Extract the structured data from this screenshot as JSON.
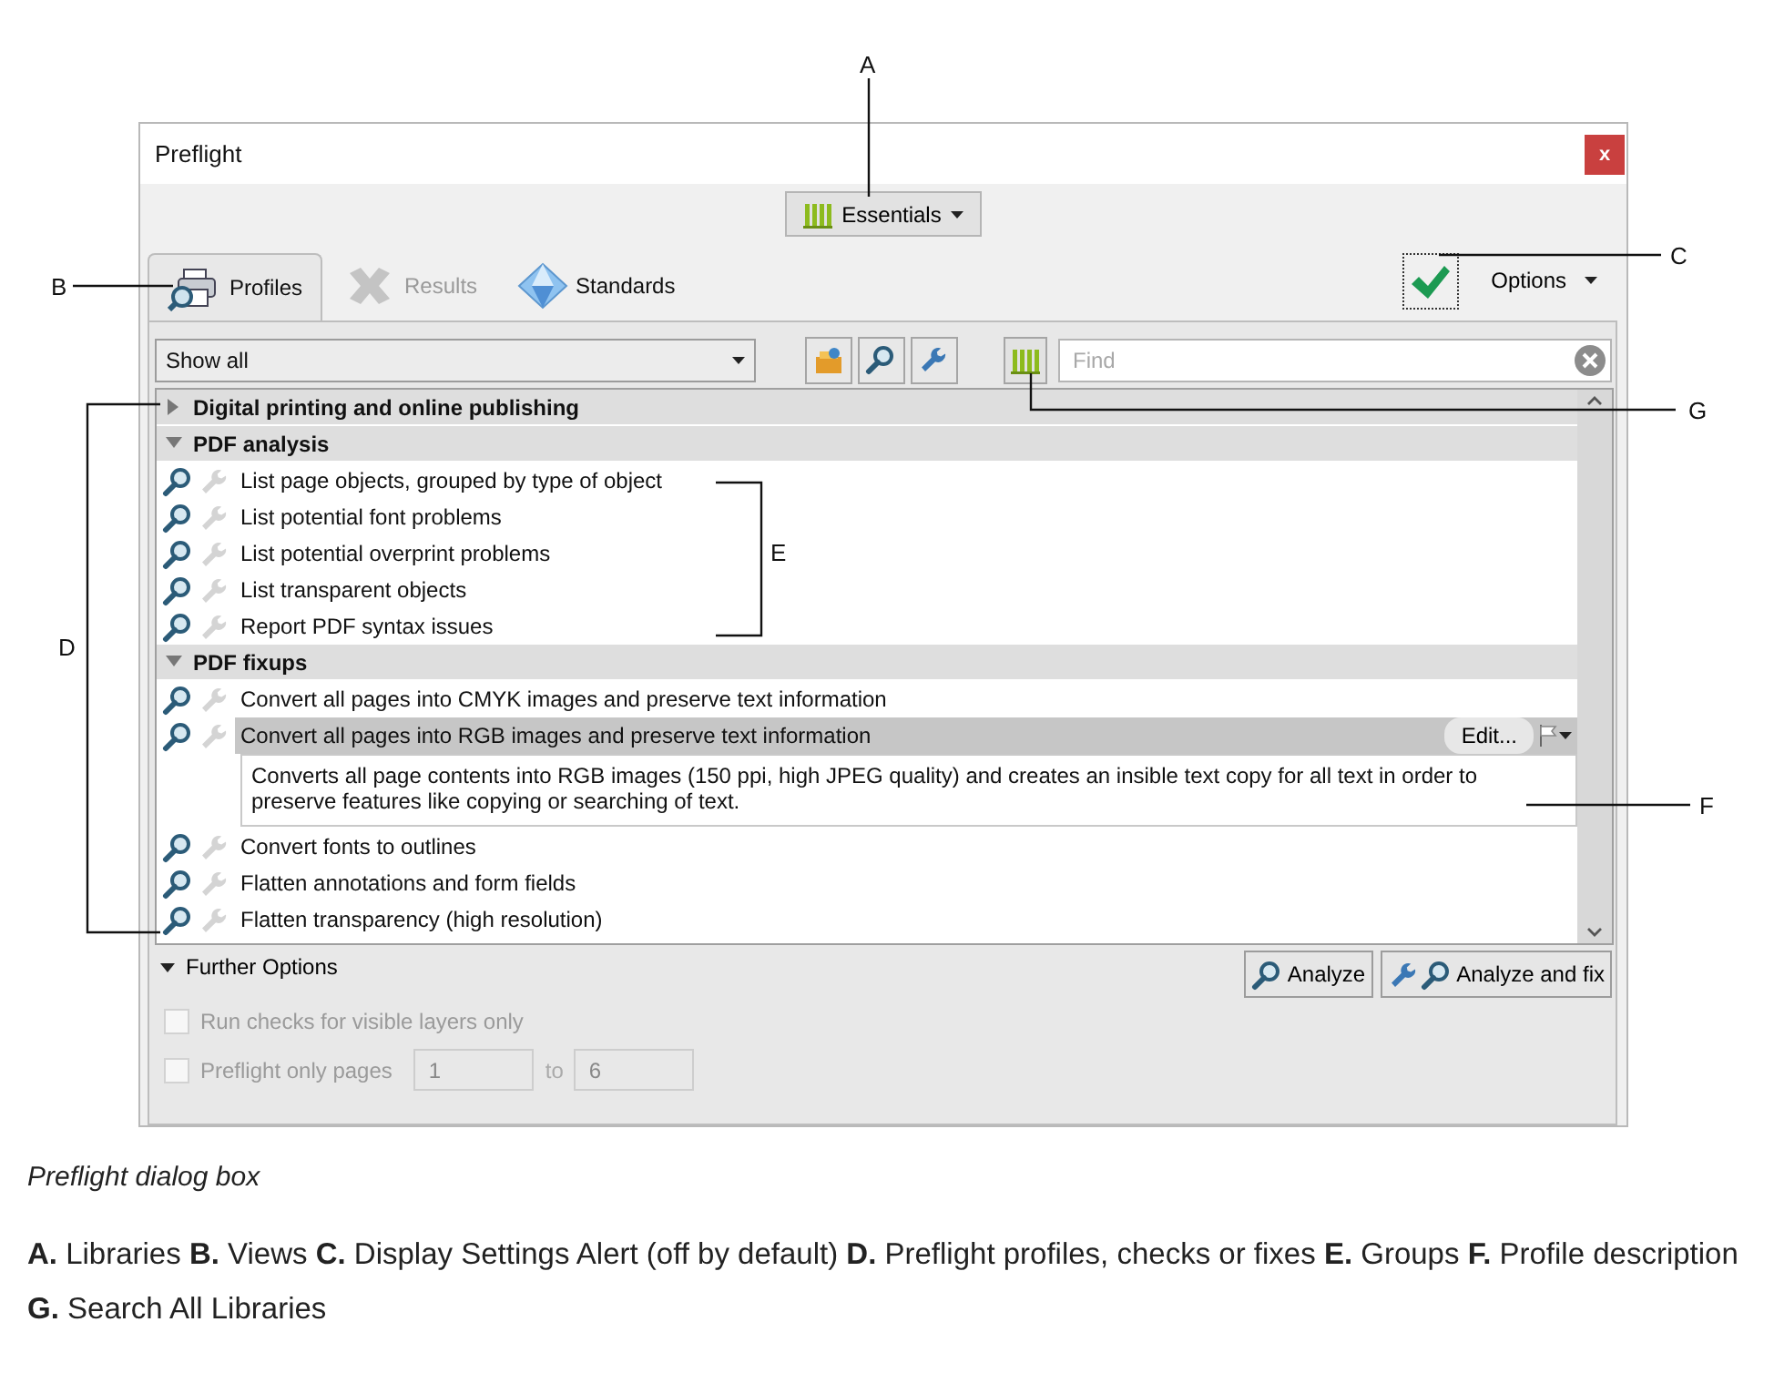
{
  "dialog": {
    "title": "Preflight",
    "close": "x",
    "library": "Essentials",
    "tabs": [
      {
        "label": "Profiles",
        "selected": true,
        "disabled": false
      },
      {
        "label": "Results",
        "selected": false,
        "disabled": true
      },
      {
        "label": "Standards",
        "selected": false,
        "disabled": false
      }
    ],
    "options": "Options",
    "filter": "Show all",
    "search": {
      "placeholder": "Find"
    },
    "groups": [
      {
        "title": "Digital printing and online publishing",
        "expanded": false
      },
      {
        "title": "PDF analysis",
        "expanded": true,
        "items": [
          {
            "label": "List page objects, grouped by type of object",
            "selected": false
          },
          {
            "label": "List potential font problems",
            "selected": false
          },
          {
            "label": "List potential overprint problems",
            "selected": false
          },
          {
            "label": "List transparent objects",
            "selected": false
          },
          {
            "label": "Report PDF syntax issues",
            "selected": false
          }
        ]
      },
      {
        "title": "PDF fixups",
        "expanded": true,
        "items": [
          {
            "label": "Convert all pages into CMYK images and preserve text information",
            "selected": false
          },
          {
            "label": "Convert all pages into RGB images and preserve text information",
            "selected": true,
            "edit": "Edit...",
            "description": "Converts all page contents into RGB images (150 ppi, high JPEG quality) and creates an insible text copy for all text in order to preserve features like copying or searching of text."
          },
          {
            "label": "Convert fonts to outlines",
            "selected": false
          },
          {
            "label": "Flatten annotations and form fields",
            "selected": false
          },
          {
            "label": "Flatten transparency (high resolution)",
            "selected": false
          }
        ]
      }
    ],
    "further_options": {
      "label": "Further Options",
      "expanded": true,
      "checks": [
        {
          "label": "Run checks for visible layers only",
          "checked": false,
          "disabled": true
        },
        {
          "label": "Preflight only pages",
          "checked": false,
          "disabled": true,
          "from": "1",
          "to_label": "to",
          "to": "6"
        }
      ]
    },
    "buttons": [
      "Analyze",
      "Analyze and fix"
    ]
  },
  "callouts": [
    {
      "letter": "A"
    },
    {
      "letter": "B"
    },
    {
      "letter": "C"
    },
    {
      "letter": "D"
    },
    {
      "letter": "E"
    },
    {
      "letter": "F"
    },
    {
      "letter": "G"
    }
  ],
  "caption": "Preflight dialog box",
  "legend": "**A.** Libraries **B.** Views **C.** Display Settings Alert (off by default)  **D.** Preflight profiles, checks or fixes **E.** Groups **F.** Profile description **G.** Search All Libraries"
}
